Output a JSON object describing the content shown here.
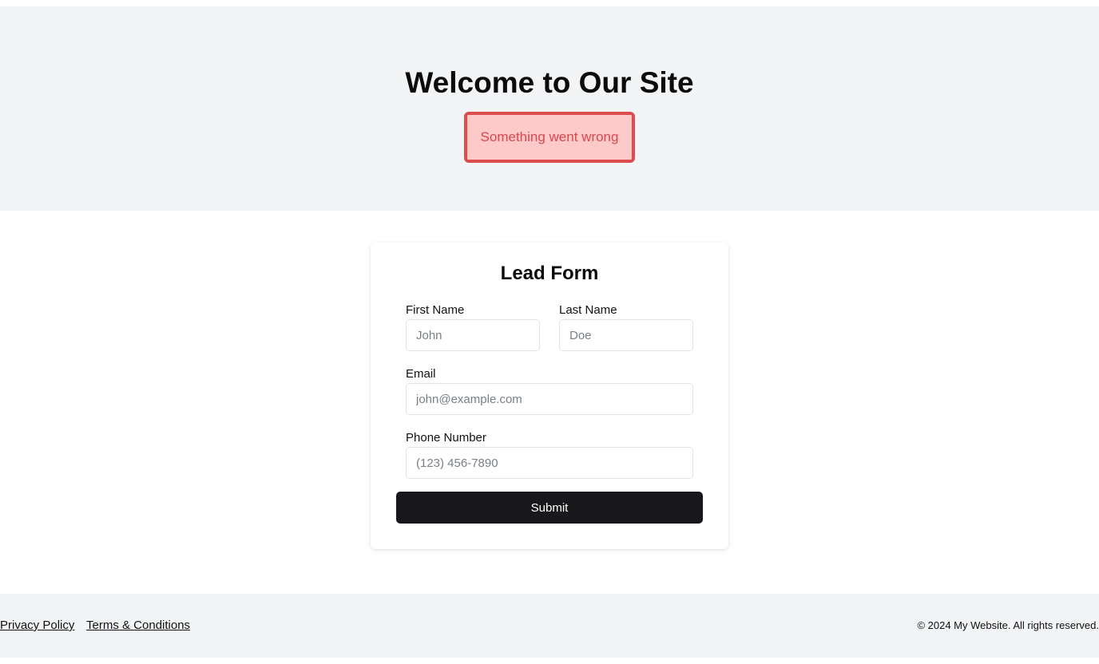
{
  "hero": {
    "title": "Welcome to Our Site",
    "error_message": "Something went wrong"
  },
  "form": {
    "title": "Lead Form",
    "fields": {
      "first_name": {
        "label": "First Name",
        "placeholder": "John",
        "value": ""
      },
      "last_name": {
        "label": "Last Name",
        "placeholder": "Doe",
        "value": ""
      },
      "email": {
        "label": "Email",
        "placeholder": "john@example.com",
        "value": ""
      },
      "phone": {
        "label": "Phone Number",
        "placeholder": "(123) 456-7890",
        "value": ""
      }
    },
    "submit_label": "Submit"
  },
  "footer": {
    "links": [
      {
        "label": "Privacy Policy"
      },
      {
        "label": "Terms & Conditions"
      }
    ],
    "copyright": "© 2024 My Website. All rights reserved."
  },
  "colors": {
    "hero_background": "#f2f4f6",
    "error_border": "#dc4e4e",
    "error_background": "#fec9c9",
    "error_text": "#d9464b",
    "button_background": "#18181b",
    "footer_background": "#f2f4f6"
  }
}
